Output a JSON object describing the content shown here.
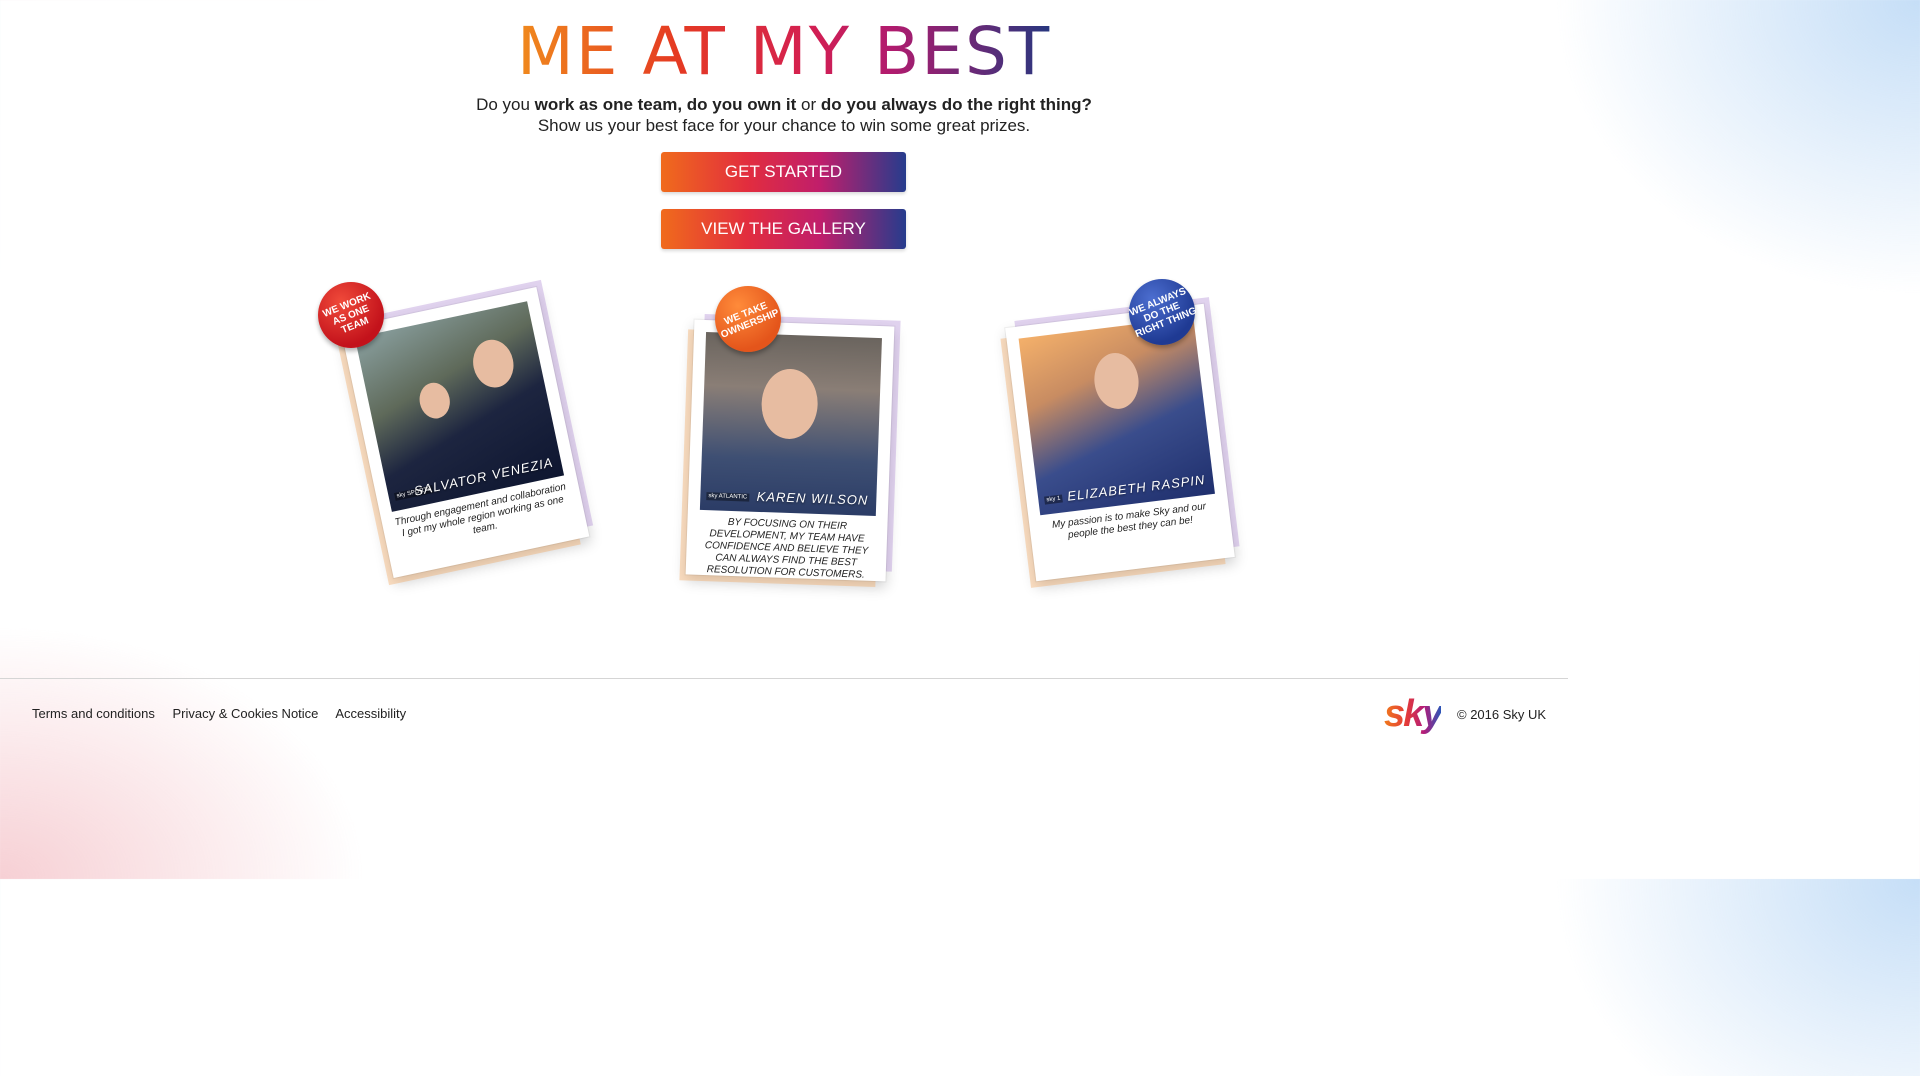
{
  "title": "ME AT MY BEST",
  "intro": {
    "pre": "Do you ",
    "b1": "work as one team, do you own it",
    "mid": " or ",
    "b2": "do you always do the right thing?",
    "line2": "Show us your best face for your chance to win some great prizes."
  },
  "buttons": {
    "start": "GET STARTED",
    "gallery": "VIEW THE GALLERY"
  },
  "cards": [
    {
      "badge": "WE WORK AS ONE TEAM",
      "name": "SALVATOR VENEZIA",
      "channel": "sky SPORTS",
      "caption": "Through engagement and collaboration I got my whole region working as one team."
    },
    {
      "badge": "WE TAKE OWNERSHIP",
      "name": "KAREN WILSON",
      "channel": "sky ATLANTIC",
      "caption": "BY FOCUSING ON THEIR DEVELOPMENT, MY TEAM HAVE CONFIDENCE AND BELIEVE THEY CAN ALWAYS FIND THE BEST RESOLUTION FOR CUSTOMERS."
    },
    {
      "badge": "WE ALWAYS DO THE RIGHT THING",
      "name": "ELIZABETH RASPIN",
      "channel": "sky 1",
      "caption": "My passion is to make Sky and our people the best they can be!"
    }
  ],
  "footer": {
    "terms": "Terms and conditions",
    "privacy": "Privacy & Cookies Notice",
    "accessibility": "Accessibility",
    "logo": "sky",
    "copyright": "© 2016 Sky UK"
  },
  "colors": {
    "accent_orange": "#f06b1c",
    "accent_red": "#e22d3e",
    "accent_blue": "#263c8d"
  }
}
